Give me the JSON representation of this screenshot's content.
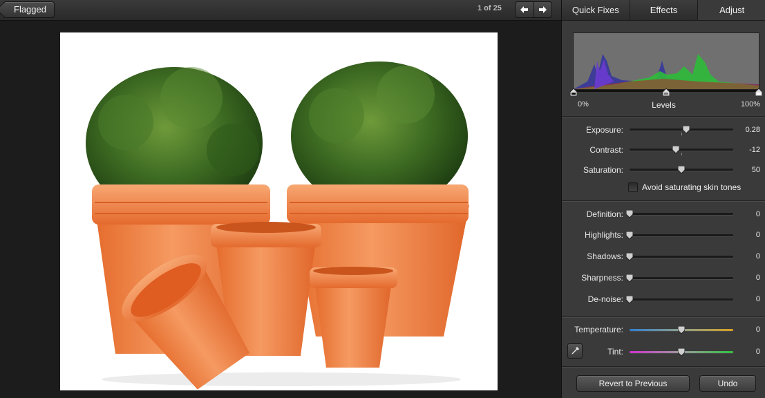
{
  "toolbar": {
    "back_label": "Flagged",
    "counter": "1 of 25",
    "prev_icon": "arrow-left-icon",
    "next_icon": "arrow-right-icon"
  },
  "tabs": [
    {
      "label": "Quick Fixes",
      "active": false
    },
    {
      "label": "Effects",
      "active": false
    },
    {
      "label": "Adjust",
      "active": true
    }
  ],
  "levels": {
    "label": "Levels",
    "min_label": "0%",
    "max_label": "100%"
  },
  "basic": {
    "exposure": {
      "label": "Exposure:",
      "value": "0.28"
    },
    "contrast": {
      "label": "Contrast:",
      "value": "-12"
    },
    "saturation": {
      "label": "Saturation:",
      "value": "50"
    },
    "skin_tones_label": "Avoid saturating skin tones"
  },
  "detail": {
    "definition": {
      "label": "Definition:",
      "value": "0"
    },
    "highlights": {
      "label": "Highlights:",
      "value": "0"
    },
    "shadows": {
      "label": "Shadows:",
      "value": "0"
    },
    "sharpness": {
      "label": "Sharpness:",
      "value": "0"
    },
    "denoise": {
      "label": "De-noise:",
      "value": "0"
    }
  },
  "white_balance": {
    "temperature": {
      "label": "Temperature:",
      "value": "0"
    },
    "tint": {
      "label": "Tint:",
      "value": "0"
    },
    "pipette_icon": "eyedropper-icon"
  },
  "actions": {
    "revert_label": "Revert to Previous",
    "undo_label": "Undo"
  },
  "colors": {
    "panel": "#3a3a3a",
    "background": "#1c1c1c",
    "pot_orange": "#f07a3c",
    "foliage": "#2f5a1e"
  }
}
